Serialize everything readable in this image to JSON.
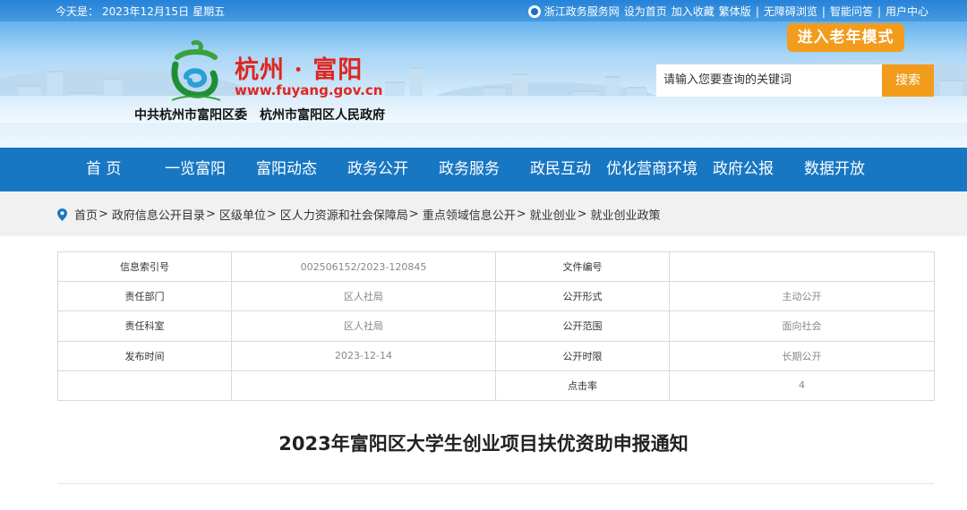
{
  "topbar": {
    "date_prefix": "今天是：",
    "date": "2023年12月15日",
    "weekday": "星期五",
    "links": [
      "浙江政务服务网",
      "设为首页",
      "加入收藏",
      "繁体版",
      "无障碍浏览",
      "智能问答",
      "用户中心"
    ]
  },
  "header": {
    "site_name": "杭州 · 富阳",
    "site_url": "www.fuyang.gov.cn",
    "org_1": "中共杭州市富阳区委",
    "org_2": "杭州市富阳区人民政府",
    "elder_mode": "进入老年模式",
    "search_placeholder": "请输入您要查询的关键词",
    "search_button": "搜索"
  },
  "nav": [
    "首 页",
    "一览富阳",
    "富阳动态",
    "政务公开",
    "政务服务",
    "政民互动",
    "优化营商环境",
    "政府公报",
    "数据开放"
  ],
  "breadcrumb": [
    "首页",
    "政府信息公开目录",
    "区级单位",
    "区人力资源和社会保障局",
    "重点领域信息公开",
    "就业创业",
    "就业创业政策"
  ],
  "info_table": [
    [
      "信息索引号",
      "002506152/2023-120845",
      "文件编号",
      ""
    ],
    [
      "责任部门",
      "区人社局",
      "公开形式",
      "主动公开"
    ],
    [
      "责任科室",
      "区人社局",
      "公开范围",
      "面向社会"
    ],
    [
      "发布时间",
      "2023-12-14",
      "公开时限",
      "长期公开"
    ],
    [
      "",
      "",
      "点击率",
      "4"
    ]
  ],
  "article": {
    "title": "2023年富阳区大学生创业项目扶优资助申报通知"
  },
  "colors": {
    "nav_blue": "#1877c3",
    "accent_orange": "#f39b1b",
    "brand_red": "#e0261f"
  }
}
